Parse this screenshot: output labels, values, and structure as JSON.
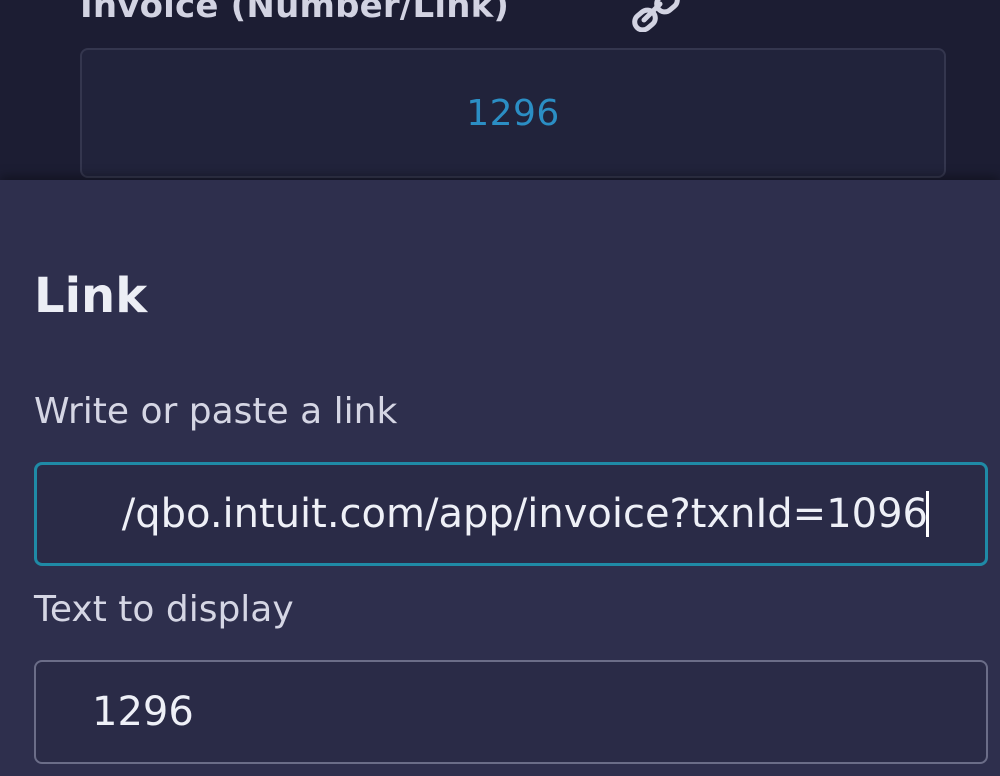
{
  "column": {
    "title": "Invoice (Number/Link)",
    "cell_value": "1296"
  },
  "link_editor": {
    "title": "Link",
    "url_label": "Write or paste a link",
    "url_value": "/qbo.intuit.com/app/invoice?txnId=1096",
    "display_label": "Text to display",
    "display_value": "1296"
  },
  "colors": {
    "background": "#1c1d33",
    "panel": "#2e2f4d",
    "cell_link": "#2b8ec4",
    "focus_border": "#1f8aa6"
  },
  "icons": [
    "link-icon",
    "text-caret"
  ]
}
